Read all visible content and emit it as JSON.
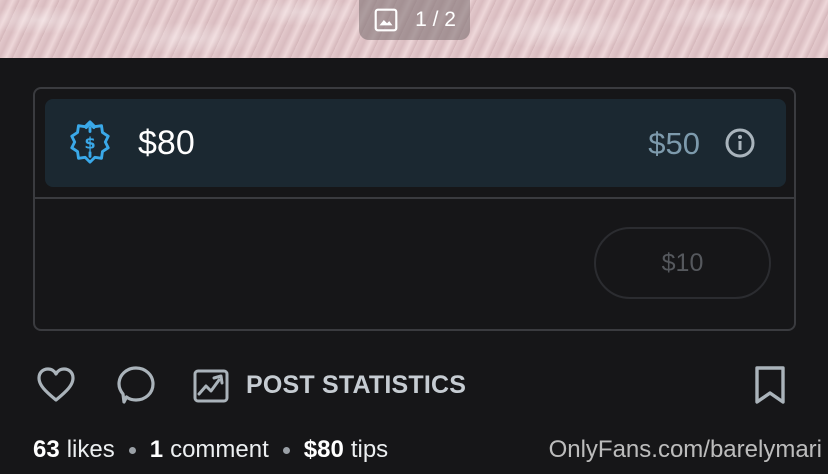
{
  "media": {
    "counter": "1 / 2",
    "icon": "image-icon"
  },
  "tip_card": {
    "amount": "$80",
    "secondary_amount": "$50",
    "amount_icon": "dollar-badge-icon",
    "info_icon": "info-icon",
    "chip_label": "$10"
  },
  "actions": {
    "like_icon": "heart-icon",
    "comment_icon": "comment-bubble-icon",
    "stats_icon": "chart-image-icon",
    "stats_label": "POST STATISTICS",
    "bookmark_icon": "bookmark-icon"
  },
  "meta": {
    "likes_count": "63",
    "likes_word": "likes",
    "comments_count": "1",
    "comments_word": "comment",
    "tips_count": "$80",
    "tips_word": "tips"
  },
  "watermark": "OnlyFans.com/barelymari",
  "colors": {
    "background": "#161618",
    "tip_panel": "#1b2831",
    "accent_blue": "#3aa9e9",
    "muted_blue": "#7d9aac"
  }
}
